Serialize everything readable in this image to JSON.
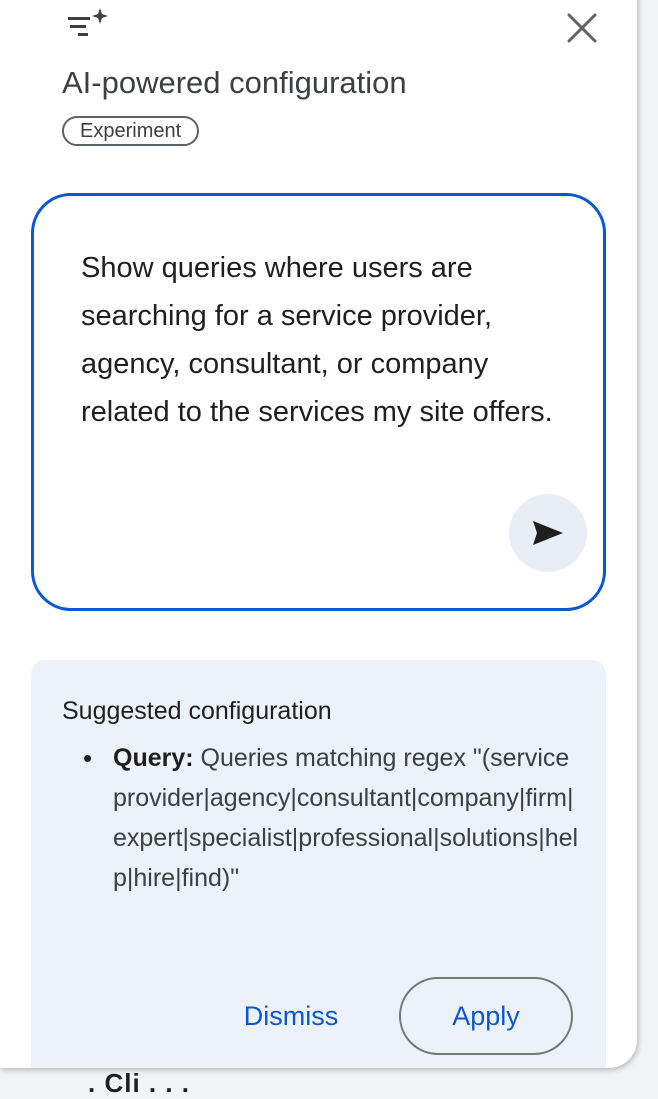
{
  "panel": {
    "title": "AI-powered configuration",
    "chip": "Experiment",
    "icons": {
      "header": "tune-sparkle-icon",
      "close": "close-icon",
      "send": "send-icon"
    }
  },
  "prompt": {
    "text": "Show queries where users are searching for a service provider, agency, consultant, or company related to the services my site offers."
  },
  "suggestion": {
    "title": "Suggested configuration",
    "items": [
      {
        "label": "Query:",
        "text": " Queries matching regex \"(service provider|agency|consultant|company|firm|expert|specialist|professional|solutions|help|hire|find)\""
      }
    ],
    "dismiss_label": "Dismiss",
    "apply_label": "Apply"
  },
  "colors": {
    "accent": "#0b57d0",
    "card_bg": "#edf2fa",
    "send_bg": "#e9eef6"
  }
}
